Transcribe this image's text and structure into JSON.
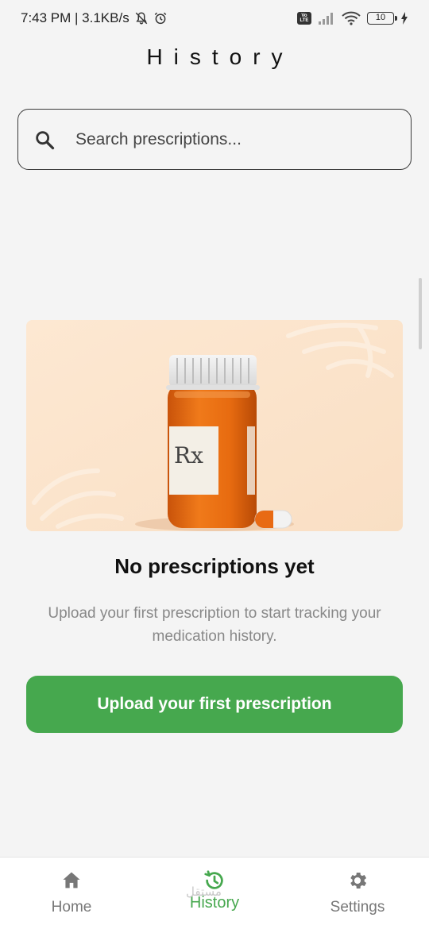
{
  "status_bar": {
    "time_speed": "7:43 PM | 3.1KB/s",
    "lte_label": "Vo LTE",
    "battery_level": "10"
  },
  "header": {
    "title": "History"
  },
  "search": {
    "placeholder": "Search prescriptions..."
  },
  "illustration": {
    "label_text": "Rx"
  },
  "empty_state": {
    "title": "No prescriptions yet",
    "subtitle": "Upload your first prescription to start tracking your medication history.",
    "button_label": "Upload your first prescription"
  },
  "bottom_nav": {
    "items": [
      {
        "label": "Home",
        "icon": "home-icon"
      },
      {
        "label": "History",
        "icon": "history-icon",
        "active": true
      },
      {
        "label": "Settings",
        "icon": "gear-icon"
      }
    ]
  },
  "watermark": "مستقل",
  "colors": {
    "accent": "#46a84e",
    "background": "#f4f4f4",
    "illustration_bg": "#fbe6cf",
    "bottle": "#e56a0f"
  }
}
